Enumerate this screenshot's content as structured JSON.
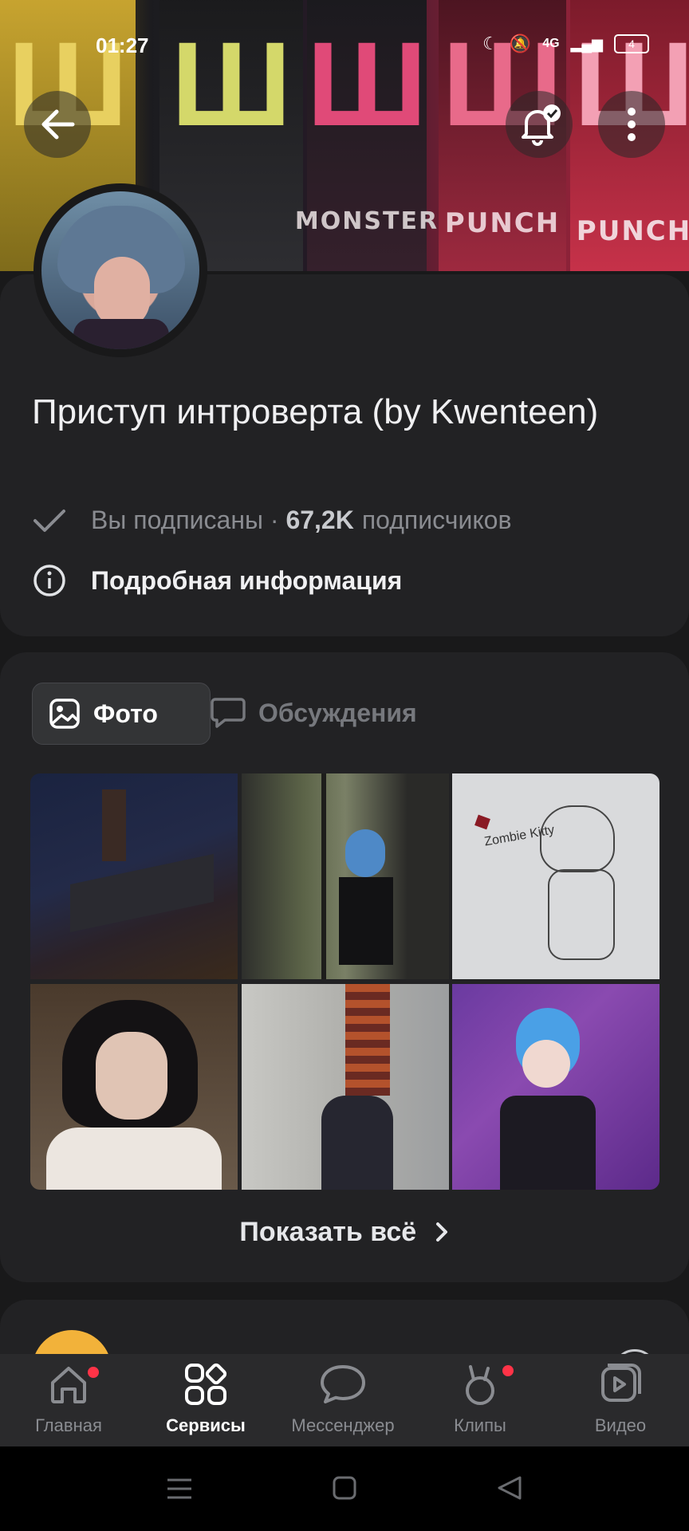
{
  "status_bar": {
    "time": "01:27",
    "network": "4G",
    "battery": "4"
  },
  "group": {
    "title": "Приступ интроверта (by Kwenteen)",
    "subscribed_text": "Вы подписаны",
    "separator": " · ",
    "subscribers_count": "67,2K",
    "subscribers_label": "подписчиков",
    "details_link": "Подробная информация"
  },
  "cover": {
    "can_texts": [
      "MONSTER",
      "PUNCH",
      "PUNCH"
    ]
  },
  "tabs": [
    {
      "label": "Фото",
      "icon": "image-icon",
      "active": true
    },
    {
      "label": "Обсуждения",
      "icon": "chat-icon",
      "active": false
    }
  ],
  "photos": {
    "show_all_label": "Показать всё",
    "items": [
      {
        "name": "dark-night-scene"
      },
      {
        "name": "blue-hair-girl-window"
      },
      {
        "name": "zombie-kitty-sketch"
      },
      {
        "name": "dark-hair-girl-portrait"
      },
      {
        "name": "striped-sweater-photo"
      },
      {
        "name": "blue-hair-girl-store"
      }
    ],
    "sketch_text": "Zombie Kitty"
  },
  "bottom_nav": [
    {
      "label": "Главная",
      "icon": "home-icon",
      "active": false,
      "badge": true
    },
    {
      "label": "Сервисы",
      "icon": "services-icon",
      "active": true,
      "badge": false
    },
    {
      "label": "Мессенджер",
      "icon": "messenger-icon",
      "active": false,
      "badge": false
    },
    {
      "label": "Клипы",
      "icon": "clips-icon",
      "active": false,
      "badge": true
    },
    {
      "label": "Видео",
      "icon": "video-icon",
      "active": false,
      "badge": false
    }
  ],
  "colors": {
    "background": "#19191a",
    "card": "#222224",
    "accent_dot": "#ff3347",
    "muted_text": "#8a8c91"
  }
}
